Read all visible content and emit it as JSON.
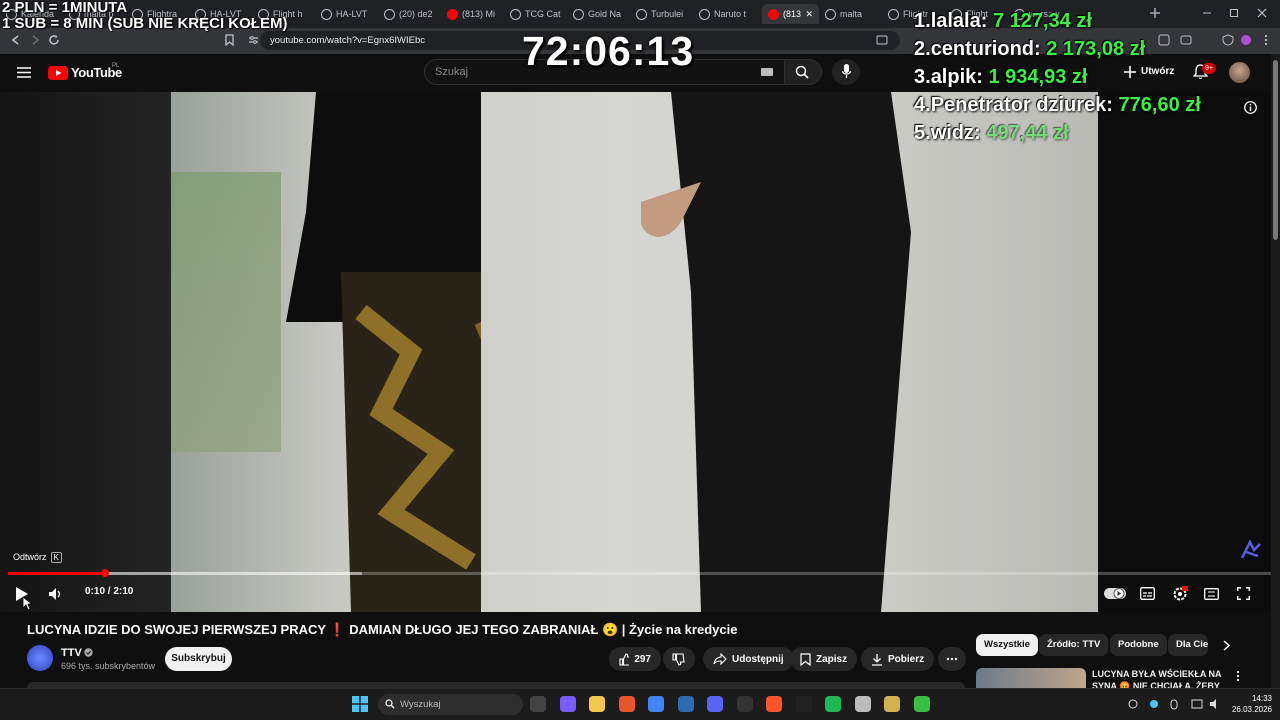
{
  "overlay": {
    "rate_line1": "2 PLN =  1MINUTA",
    "rate_line2": "1 SUB = 8 MIN (SUB NIE KRĘCI KOŁEM)",
    "timer": "72:06:13",
    "leaderboard": [
      {
        "rank": "1.",
        "name": "lalala:",
        "amount": "7 127,34 zł"
      },
      {
        "rank": "2.",
        "name": "centuriond:",
        "amount": "2 173,08 zł"
      },
      {
        "rank": "3.",
        "name": "alpik:",
        "amount": "1 934,93 zł"
      },
      {
        "rank": "4.",
        "name": "Penetrator dziurek:",
        "amount": "776,60 zł"
      },
      {
        "rank": "5.",
        "name": "widz:",
        "amount": "497,44 zł"
      }
    ]
  },
  "browser": {
    "tabs": [
      "Kalenda",
      "malta p",
      "Flightra",
      "HA-LVT",
      "Flight h",
      "HA-LVT",
      "(20) de2",
      "(813) Mi",
      "TCG Cat",
      "Gold Na",
      "Turbulei",
      "Naruto t",
      "(813",
      "malta",
      "Flightr",
      "Flight",
      "warsaw"
    ],
    "active_tab_index": 12,
    "url": "youtube.com/watch?v=Egnx6IWIEbc"
  },
  "youtube": {
    "logo": "YouTube",
    "region": "PL",
    "search_placeholder": "Szukaj",
    "create_label": "Utwórz",
    "notif_count": "9+"
  },
  "player": {
    "tooltip_label": "Odtwórz",
    "tooltip_key": "K",
    "current_time": "0:10",
    "duration": "2:10",
    "time_display": "0:10 / 2:10",
    "progress_fraction": 0.077,
    "buffered_fraction": 0.28
  },
  "video": {
    "title": "LUCYNA IDZIE DO SWOJEJ PIERWSZEJ PRACY ❗ DAMIAN DŁUGO JEJ TEGO ZABRANIAŁ 😮 | Życie na kredycie",
    "channel": "TTV",
    "subscribers": "696 tys. subskrybentów",
    "subscribe_label": "Subskrybuj",
    "likes": "297",
    "share_label": "Udostępnij",
    "save_label": "Zapisz",
    "download_label": "Pobierz"
  },
  "chips": [
    "Wszystkie",
    "Źródło: TTV",
    "Podobne",
    "Dla Ciebie"
  ],
  "recommendation": {
    "title": "LUCYNA BYŁA WŚCIEKŁA NA SYNA 😡 NIE CHCIAŁA, ŻEBY"
  },
  "taskbar": {
    "search_placeholder": "Wyszukaj",
    "time": "14:33",
    "date": "26.03.2026"
  },
  "colors": {
    "accent_red": "#ff0000",
    "leader_green": "#3cf043",
    "yt_bg": "#0f0f0f"
  }
}
